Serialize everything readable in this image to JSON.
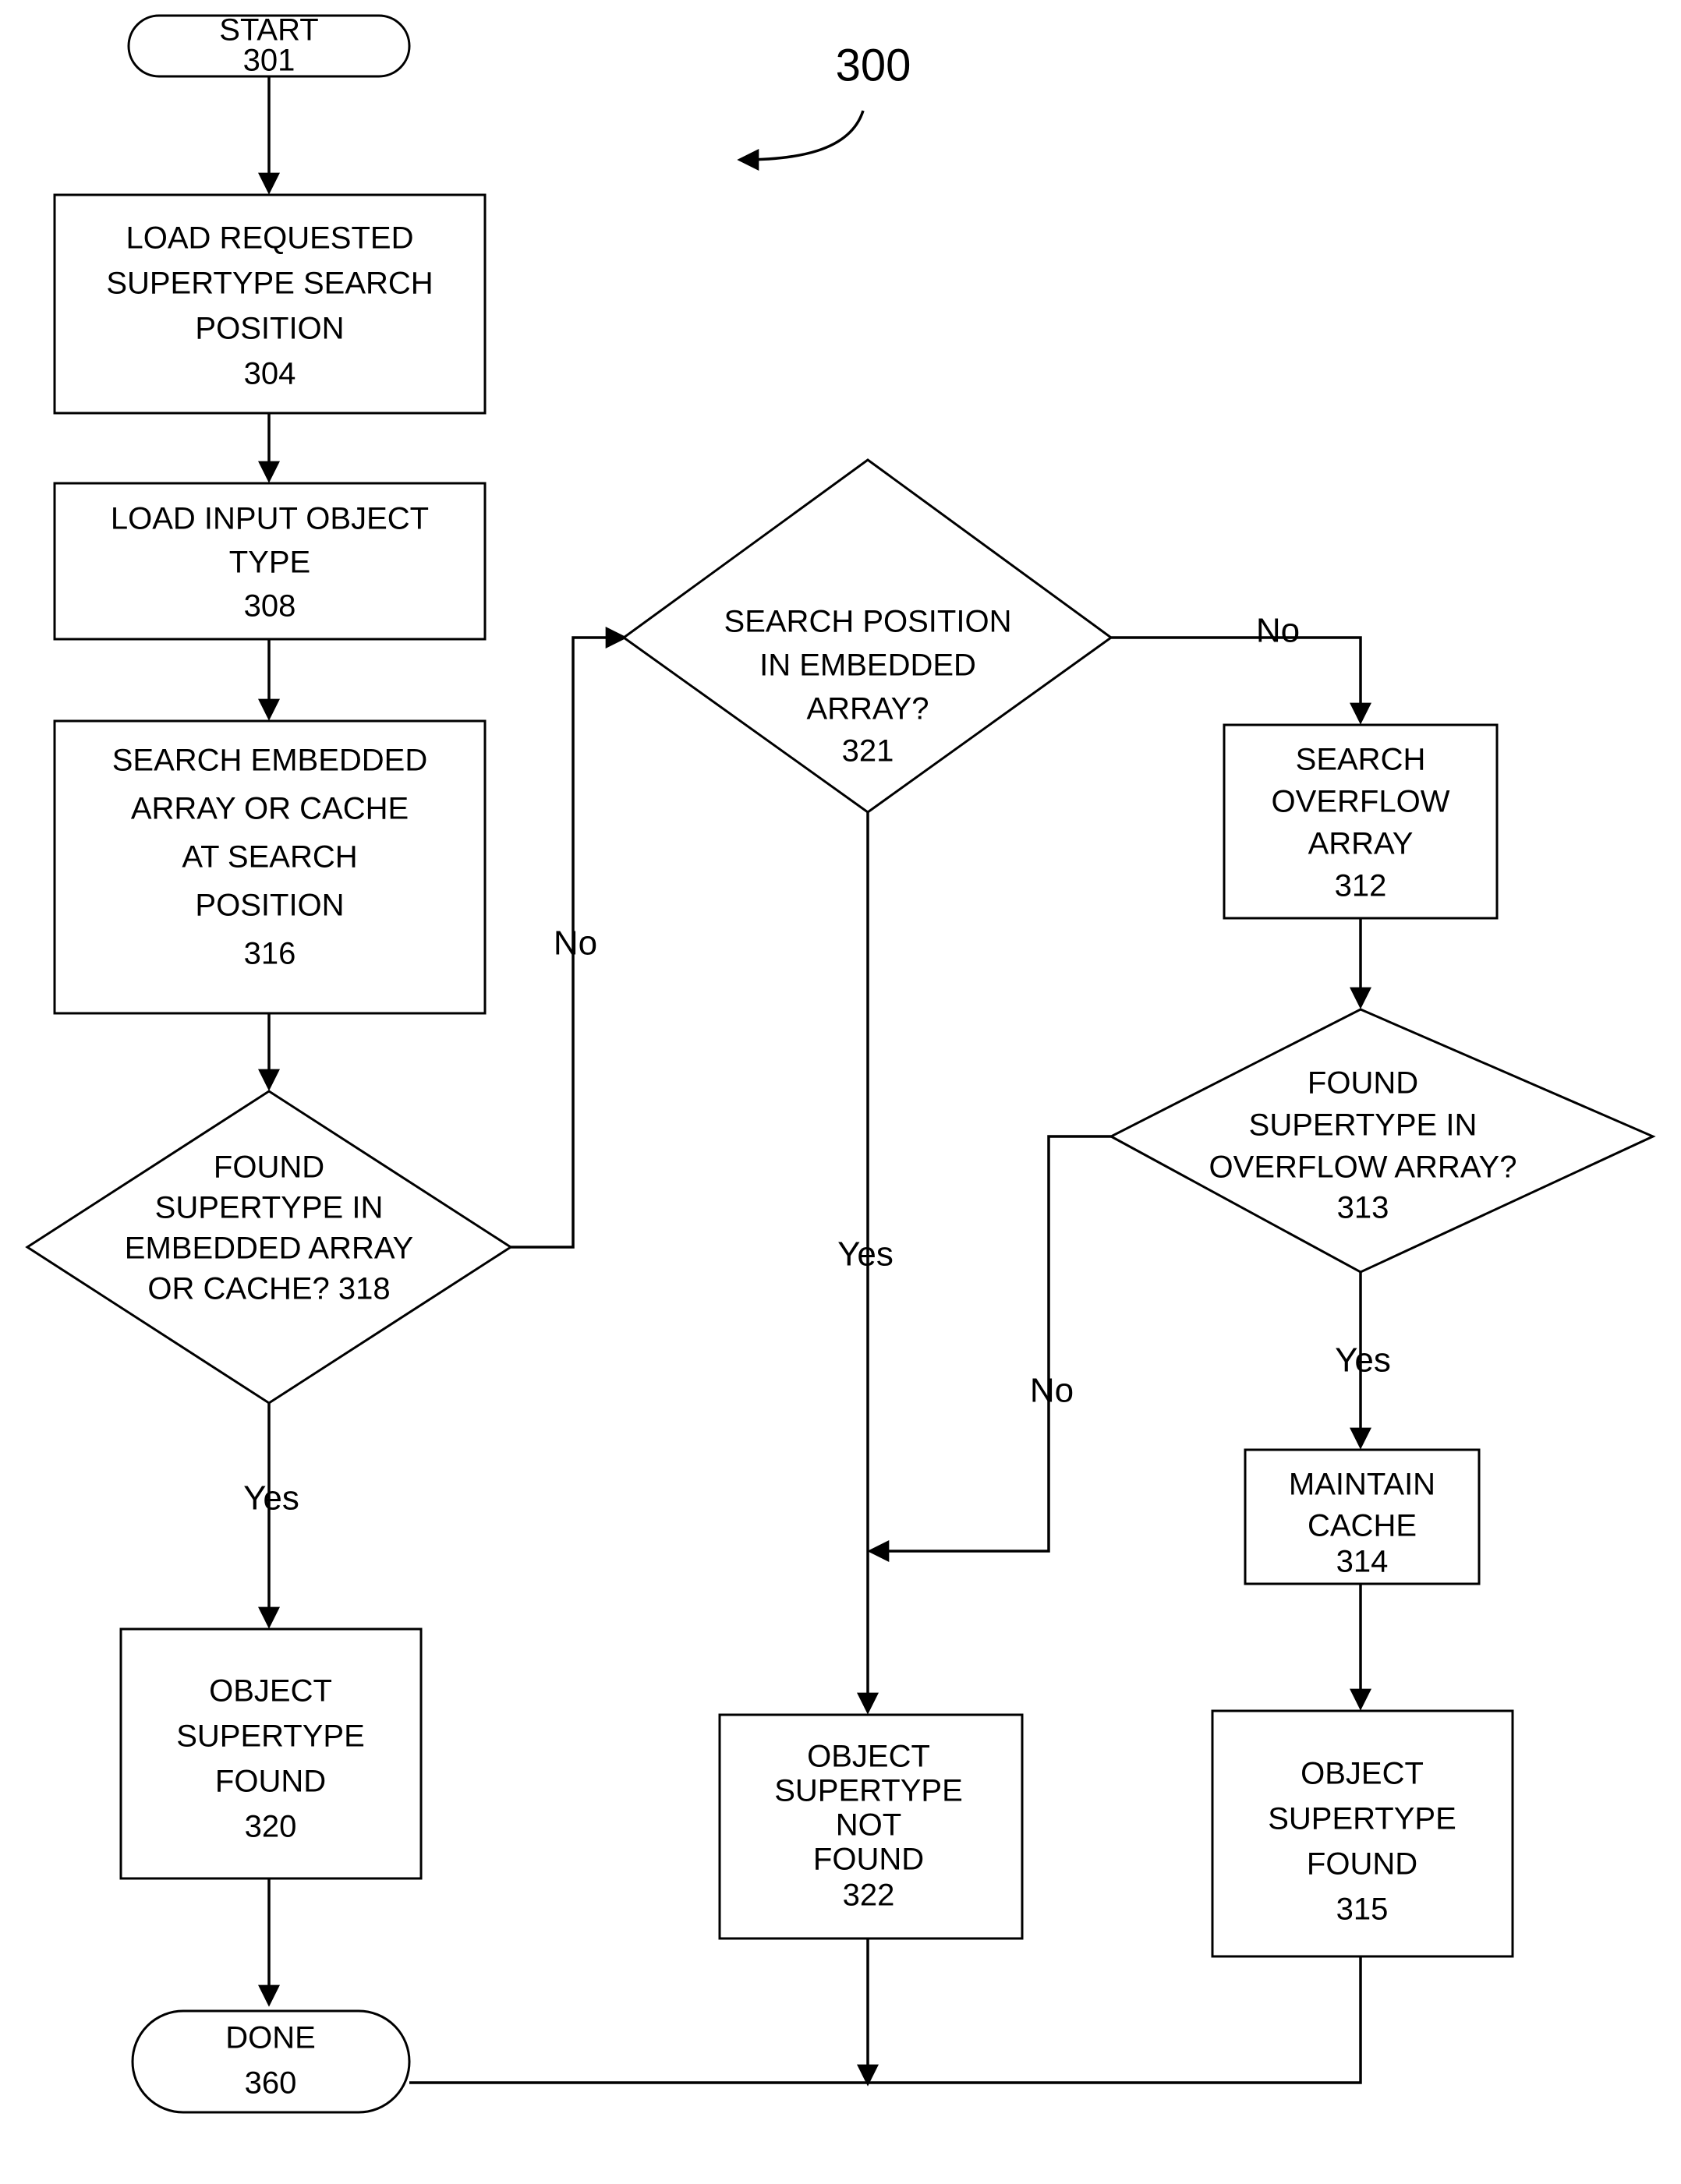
{
  "figure": {
    "reference_numeral": "300"
  },
  "nodes": {
    "start": {
      "shape": "terminator",
      "lines": [
        "START",
        "301"
      ]
    },
    "load_search_position": {
      "shape": "process",
      "lines": [
        "LOAD REQUESTED",
        "SUPERTYPE SEARCH",
        "POSITION",
        "304"
      ]
    },
    "load_input_object_type": {
      "shape": "process",
      "lines": [
        "LOAD INPUT OBJECT",
        "TYPE",
        "308"
      ]
    },
    "search_embedded": {
      "shape": "process",
      "lines": [
        "SEARCH EMBEDDED",
        "ARRAY OR  CACHE",
        "AT SEARCH",
        "POSITION",
        "316"
      ]
    },
    "found_embedded_decision": {
      "shape": "decision",
      "lines": [
        "FOUND",
        "SUPERTYPE IN",
        "EMBEDDED ARRAY",
        "OR CACHE?  318"
      ]
    },
    "object_supertype_found_320": {
      "shape": "process",
      "lines": [
        "OBJECT",
        "SUPERTYPE",
        "FOUND",
        "320"
      ]
    },
    "done": {
      "shape": "terminator",
      "lines": [
        "DONE",
        "360"
      ]
    },
    "search_position_decision": {
      "shape": "decision",
      "lines": [
        "SEARCH POSITION",
        "IN EMBEDDED",
        "ARRAY?",
        "321"
      ]
    },
    "object_supertype_not_found_322": {
      "shape": "process",
      "lines": [
        "OBJECT",
        "SUPERTYPE",
        "NOT",
        "FOUND",
        "322"
      ]
    },
    "search_overflow": {
      "shape": "process",
      "lines": [
        "SEARCH",
        "OVERFLOW",
        "ARRAY",
        "312"
      ]
    },
    "found_overflow_decision": {
      "shape": "decision",
      "lines": [
        "FOUND",
        "SUPERTYPE IN",
        "OVERFLOW ARRAY?",
        "313"
      ]
    },
    "maintain_cache": {
      "shape": "process",
      "lines": [
        "MAINTAIN",
        "CACHE",
        "314"
      ]
    },
    "object_supertype_found_315": {
      "shape": "process",
      "lines": [
        "OBJECT",
        "SUPERTYPE",
        "FOUND",
        "315"
      ]
    }
  },
  "edge_labels": {
    "embedded_no": "No",
    "embedded_yes": "Yes",
    "search_position_no": "No",
    "search_position_yes": "Yes",
    "overflow_no": "No",
    "overflow_yes": "Yes"
  },
  "colors": {
    "stroke": "#000000",
    "fill": "#ffffff",
    "background": "#ffffff"
  }
}
